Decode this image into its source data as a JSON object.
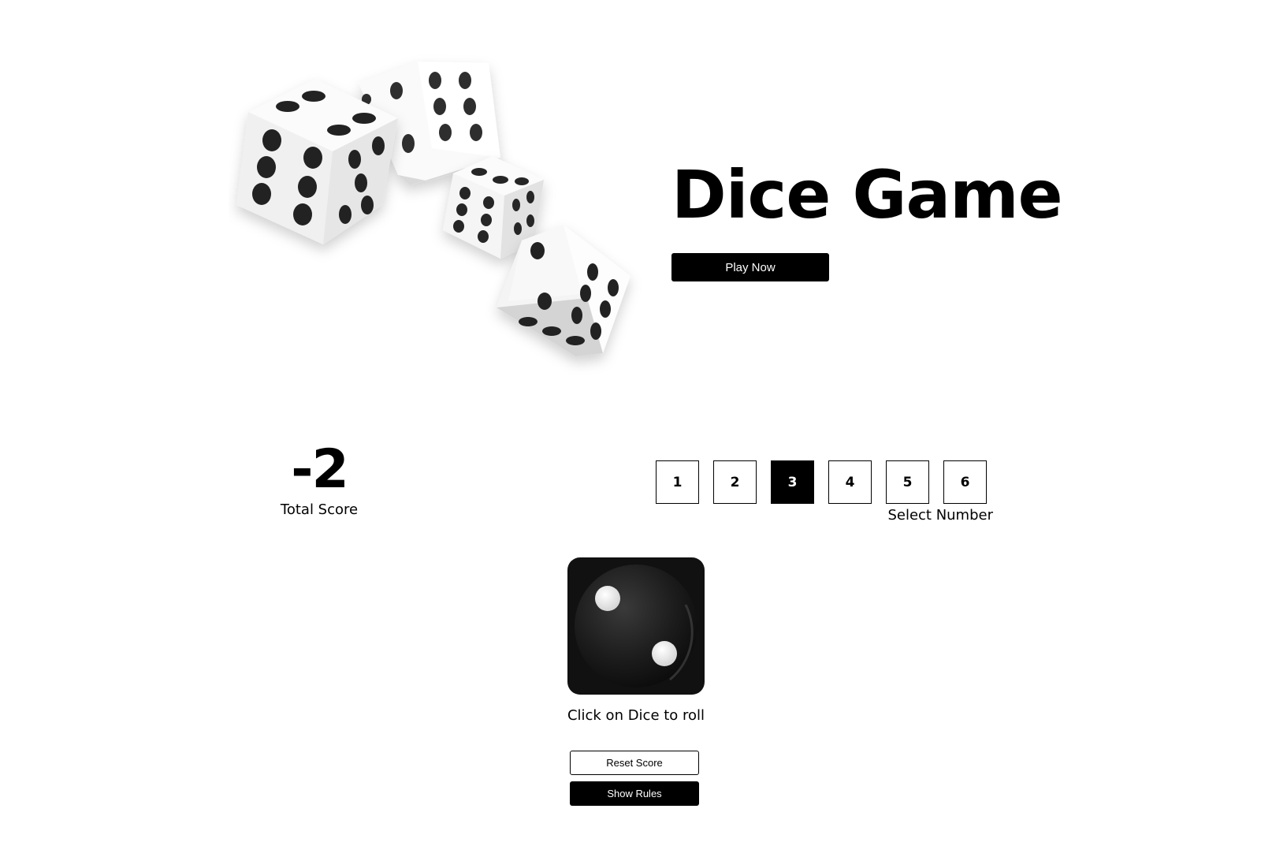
{
  "hero": {
    "title": "Dice Game",
    "play_button": "Play Now",
    "illustration_icon": "dice-group-icon"
  },
  "score": {
    "value": "-2",
    "label": "Total Score"
  },
  "selector": {
    "numbers": [
      "1",
      "2",
      "3",
      "4",
      "5",
      "6"
    ],
    "selected": "3",
    "label": "Select Number"
  },
  "dice": {
    "current_face": 2,
    "caption": "Click on Dice to roll",
    "icon": "dice-face-2-icon"
  },
  "actions": {
    "reset_label": "Reset Score",
    "rules_label": "Show Rules"
  },
  "colors": {
    "primary": "#000000",
    "background": "#ffffff",
    "dice_face": "#1a1a1a"
  }
}
